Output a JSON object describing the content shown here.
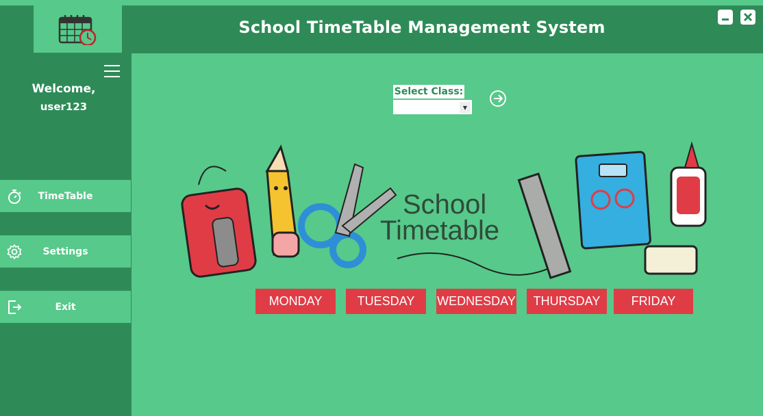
{
  "window": {
    "title": "School TimeTable Management System",
    "minimize_icon": "minimize-icon",
    "close_icon": "close-icon"
  },
  "logo": {
    "icon": "calendar-clock-icon"
  },
  "sidebar": {
    "menu_icon": "hamburger-menu-icon",
    "welcome": "Welcome,",
    "username": "user123",
    "items": [
      {
        "label": "TimeTable",
        "icon": "stopwatch-icon"
      },
      {
        "label": "Settings",
        "icon": "gear-icon"
      },
      {
        "label": "Exit",
        "icon": "exit-icon"
      }
    ]
  },
  "main": {
    "select_label": "Select Class:",
    "select_value": "",
    "go_icon": "arrow-right-circle-icon",
    "banner_title_line1": "School",
    "banner_title_line2": "Timetable",
    "days": [
      "MONDAY",
      "TUESDAY",
      "WEDNESDAY",
      "THURSDAY",
      "FRIDAY"
    ]
  },
  "colors": {
    "dark_green": "#2e8b57",
    "light_green": "#57c98a",
    "day_red": "#e03c46"
  }
}
